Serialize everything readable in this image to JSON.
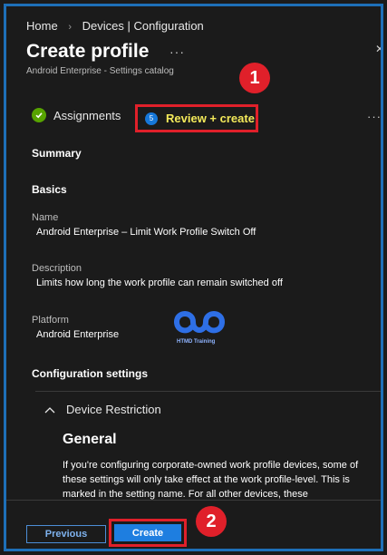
{
  "breadcrumb": {
    "home": "Home",
    "sep": "›",
    "current": "Devices | Configuration"
  },
  "header": {
    "title": "Create profile",
    "more": "···",
    "close": "✕",
    "subtitle": "Android Enterprise - Settings catalog"
  },
  "tabs": {
    "assignments": "Assignments",
    "review": "Review + create",
    "review_step": "5",
    "more": "···"
  },
  "callouts": {
    "one": "1",
    "two": "2"
  },
  "summary": {
    "heading": "Summary",
    "basics": "Basics",
    "name_label": "Name",
    "name_value": "Android Enterprise – Limit Work Profile Switch Off",
    "description_label": "Description",
    "description_value": "Limits how long the work profile can remain switched off",
    "platform_label": "Platform",
    "platform_value": "Android Enterprise",
    "config_heading": "Configuration settings"
  },
  "watermark": "HTMD Training",
  "accordion": {
    "label": "Device Restriction",
    "chevron": "∧"
  },
  "general": {
    "heading": "General",
    "text": "If you're configuring corporate-owned work profile devices, some of these settings will only take effect at the work profile-level. This is marked in the setting name. For all other devices, these"
  },
  "footer": {
    "previous": "Previous",
    "create": "Create"
  },
  "colors": {
    "accent": "#1e7ee0",
    "callout": "#e0202a",
    "highlight_text": "#f3e95a",
    "success": "#57a300"
  }
}
